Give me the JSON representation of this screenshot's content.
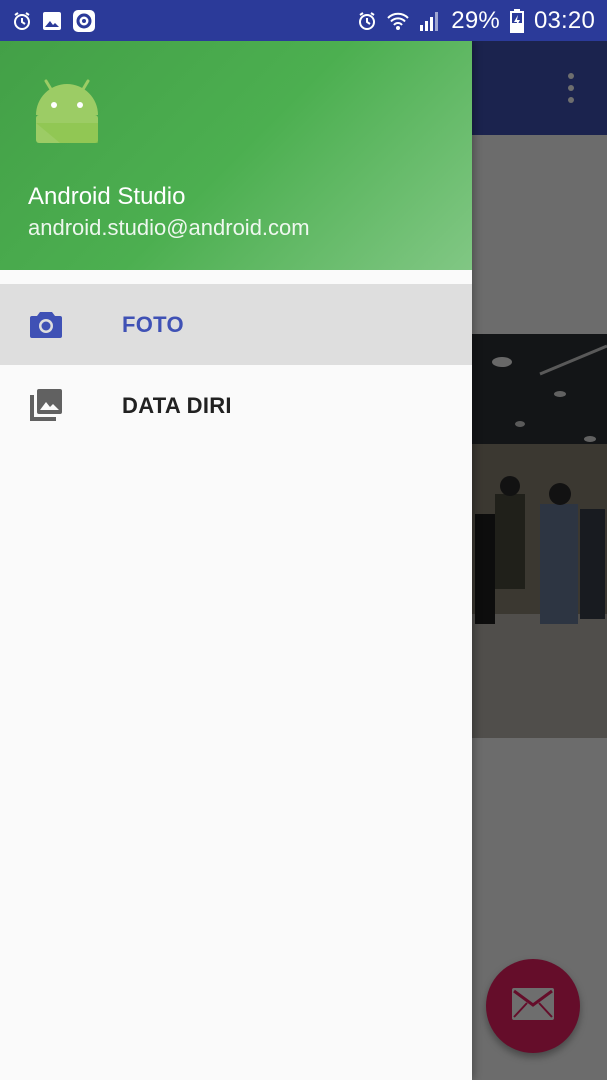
{
  "status_bar": {
    "battery_percent": "29%",
    "time": "03:20",
    "left_icons": [
      "alarm-icon",
      "image-notification-icon",
      "circle-app-icon"
    ],
    "right_icons": [
      "alarm-icon",
      "wifi-icon",
      "signal-icon",
      "battery-icon"
    ]
  },
  "toolbar": {
    "overflow_icon": "more-vert-icon"
  },
  "drawer": {
    "header": {
      "name": "Android Studio",
      "email": "android.studio@android.com",
      "avatar_icon": "android-icon"
    },
    "items": [
      {
        "label": "FOTO",
        "icon": "camera-icon",
        "selected": true
      },
      {
        "label": "DATA DIRI",
        "icon": "photo-library-icon",
        "selected": false
      }
    ]
  },
  "fab": {
    "icon": "email-icon"
  },
  "colors": {
    "status_bar": "#2b3a99",
    "toolbar": "#3f51b5",
    "header_green": "#4caf50",
    "accent": "#e91e63",
    "selected_text": "#3f51b5"
  }
}
